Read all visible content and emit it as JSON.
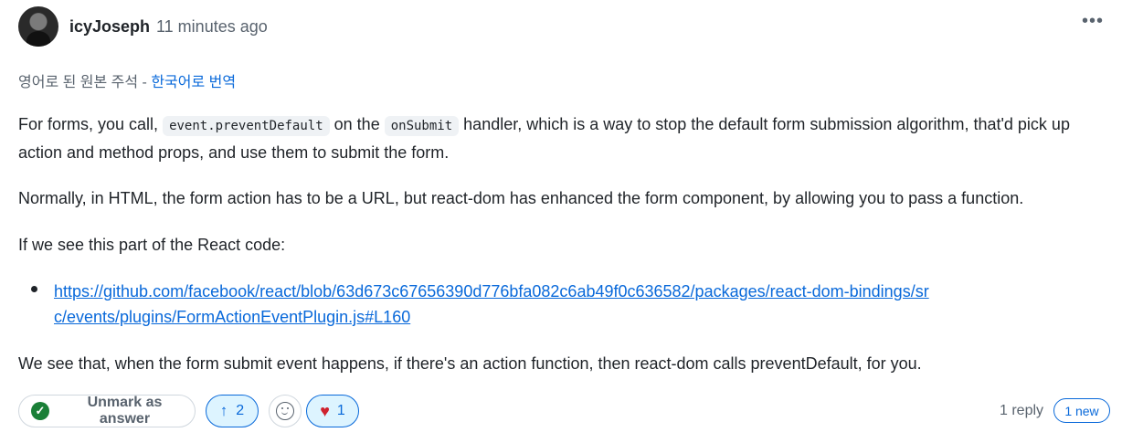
{
  "comment": {
    "author": "icyJoseph",
    "time": "11 minutes ago",
    "translation_note_prefix": "영어로 된 원본 주석 -",
    "translation_link": "한국어로 번역",
    "paragraph1_a": "For forms, you call,",
    "code1": "event.preventDefault",
    "paragraph1_b": "on the",
    "code2": "onSubmit",
    "paragraph1_c": "handler, which is a way to stop the default form submission algorithm, that'd pick up action and method props, and use them to submit the form.",
    "paragraph2": "Normally, in HTML, the form action has to be a URL, but react-dom has enhanced the form component, by allowing you to pass a function.",
    "paragraph3": "If we see this part of the React code:",
    "link": "https://github.com/facebook/react/blob/63d673c67656390d776bfa082c6ab49f0c636582/packages/react-dom-bindings/src/events/plugins/FormActionEventPlugin.js#L160",
    "paragraph4": "We see that, when the form submit event happens, if there's an action function, then react-dom calls preventDefault, for you."
  },
  "toolbar": {
    "unmark_label": "Unmark as answer",
    "upvotes": "2",
    "hearts": "1",
    "reply_count": "1 reply",
    "new_label": "1 new"
  },
  "icons": {
    "more": "more-horizontal-icon",
    "check": "check-circle-icon",
    "upvote": "arrow-up-icon",
    "emoji": "smiley-icon",
    "heart": "heart-icon"
  },
  "colors": {
    "link": "#0969da",
    "success": "#1a7f37",
    "heart": "#cf222e",
    "muted": "#59636e"
  }
}
